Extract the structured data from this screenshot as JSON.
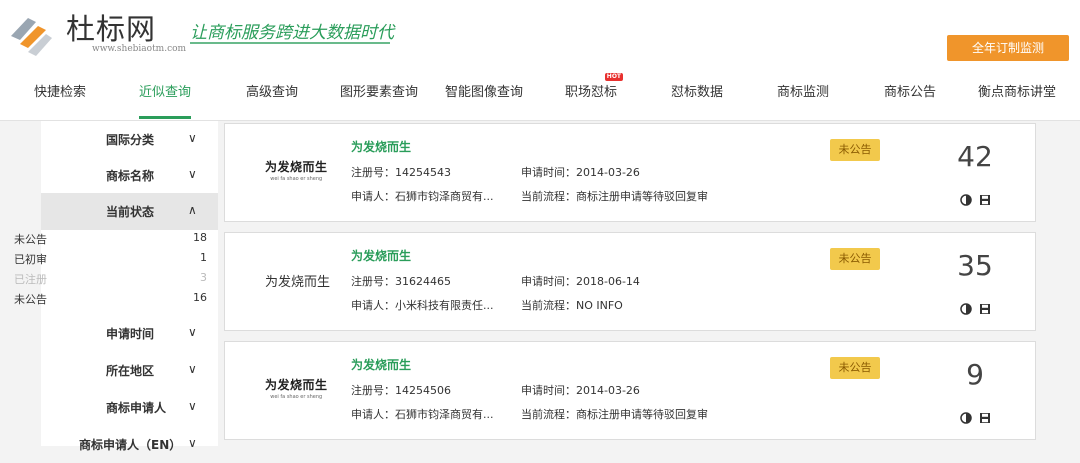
{
  "header": {
    "brand": "杜标网",
    "brand_url": "www.shebiaotm.com",
    "slogan": "让商标服务跨进大数据时代",
    "subscribe_button": "全年订制监测"
  },
  "nav": {
    "items": [
      {
        "label": "快捷检索"
      },
      {
        "label": "近似查询"
      },
      {
        "label": "高级查询"
      },
      {
        "label": "图形要素查询"
      },
      {
        "label": "智能图像查询"
      },
      {
        "label": "职场怼标",
        "badge": "HOT"
      },
      {
        "label": "怼标数据"
      },
      {
        "label": "商标监测"
      },
      {
        "label": "商标公告"
      },
      {
        "label": "衡点商标讲堂"
      }
    ],
    "active_index": 1
  },
  "sidebar": {
    "filters_top": [
      {
        "label": "国际分类"
      },
      {
        "label": "商标名称"
      },
      {
        "label": "当前状态"
      }
    ],
    "status_items": [
      {
        "label": "未公告",
        "count": "18"
      },
      {
        "label": "已初审",
        "count": "1"
      },
      {
        "label": "已注册",
        "count": "3"
      },
      {
        "label": "未公告",
        "count": "16"
      }
    ],
    "filters_bottom": [
      {
        "label": "申请时间"
      },
      {
        "label": "所在地区"
      },
      {
        "label": "商标申请人"
      },
      {
        "label": "商标申请人（EN）"
      }
    ]
  },
  "results": [
    {
      "mark_text": "为发烧而生",
      "mark_pinyin": "wei fa shao er sheng",
      "name": "为发烧而生",
      "reg_label": "注册号：",
      "reg_no": "14254543",
      "date_label": "申请时间：",
      "date": "2014-03-26",
      "applicant_label": "申请人：",
      "applicant": "石狮市钧泽商贸有...",
      "process_label": "当前流程：",
      "process": "商标注册申请等待驳回复审",
      "status": "未公告",
      "score": "42"
    },
    {
      "mark_text": "为发烧而生",
      "name": "为发烧而生",
      "reg_label": "注册号：",
      "reg_no": "31624465",
      "date_label": "申请时间：",
      "date": "2018-06-14",
      "applicant_label": "申请人：",
      "applicant": "小米科技有限责任...",
      "process_label": "当前流程：",
      "process": "NO INFO",
      "status": "未公告",
      "score": "35"
    },
    {
      "mark_text": "为发烧而生",
      "mark_pinyin": "wei fa shao er sheng",
      "name": "为发烧而生",
      "reg_label": "注册号：",
      "reg_no": "14254506",
      "date_label": "申请时间：",
      "date": "2014-03-26",
      "applicant_label": "申请人：",
      "applicant": "石狮市钧泽商贸有...",
      "process_label": "当前流程：",
      "process": "商标注册申请等待驳回复审",
      "status": "未公告",
      "score": "9"
    }
  ],
  "colors": {
    "accent": "#2a9d5a",
    "orange": "#f0952b",
    "badge": "#f2c94c"
  }
}
